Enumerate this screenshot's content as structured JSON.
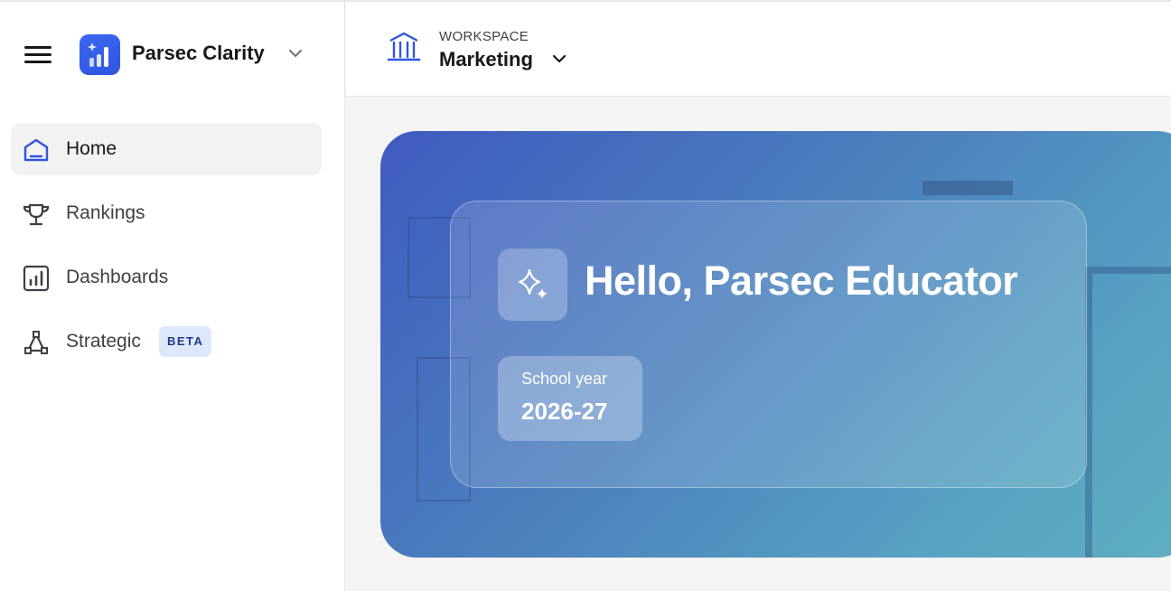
{
  "app": {
    "name": "Parsec Clarity",
    "logo_icon": "bar-chart-sparkle-icon",
    "accent_color": "#2f55e0"
  },
  "sidebar": {
    "items": [
      {
        "label": "Home",
        "icon": "home-icon",
        "active": true
      },
      {
        "label": "Rankings",
        "icon": "trophy-icon",
        "active": false
      },
      {
        "label": "Dashboards",
        "icon": "dashboard-icon",
        "active": false
      },
      {
        "label": "Strategic",
        "icon": "strategy-icon",
        "active": false,
        "badge": "BETA"
      }
    ]
  },
  "workspace": {
    "caption": "WORKSPACE",
    "name": "Marketing",
    "icon": "building-icon"
  },
  "hero": {
    "greeting": "Hello, Parsec Educator",
    "icon": "sparkles-icon",
    "school_year": {
      "caption": "School year",
      "value": "2026-27"
    }
  }
}
